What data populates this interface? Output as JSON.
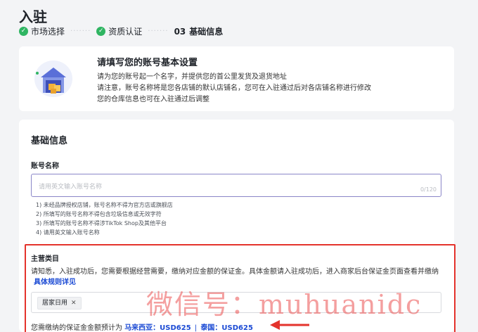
{
  "page": {
    "title": "入驻"
  },
  "steps": [
    {
      "label": "市场选择",
      "state": "done"
    },
    {
      "label": "资质认证",
      "state": "done"
    },
    {
      "number": "03",
      "label": "基础信息",
      "state": "active"
    }
  ],
  "intro": {
    "title": "请填写您的账号基本设置",
    "lines": [
      "请为您的账号起一个名字，并提供您的首公里发货及退货地址",
      "请注意，账号名称将是您各店铺的默认店铺名，您可在入驻通过后对各店铺名称进行修改",
      "您的仓库信息也可在入驻通过后调整"
    ]
  },
  "form": {
    "section_title": "基础信息",
    "account_name": {
      "label": "账号名称",
      "placeholder": "请用英文输入账号名称",
      "counter": "0/120",
      "rules": [
        "1) 未经品牌授权店铺，账号名称不得为官方店或旗舰店",
        "2) 所填写的账号名称不得包含垃圾信息或无效字符",
        "3) 所填写的账号名称不得涉TikTok Shop及其他平台",
        "4) 请用英文输入账号名称"
      ]
    },
    "category": {
      "label": "主营类目",
      "description": "请知悉，入驻成功后，您需要根据经营需要，缴纳对应金额的保证金。具体金额请入驻成功后，进入商家后台保证金页面查看并缴纳",
      "link": "具体规则详见",
      "selected_tag": "居家日用",
      "deposit_prefix": "您需缴纳的保证金金额预计为",
      "deposit_my": "马来西亚：USD625",
      "deposit_sep": "|",
      "deposit_th": "泰国：USD625"
    }
  },
  "watermark": "微信号：muhuanidc",
  "colors": {
    "accent": "#1b4ad4",
    "success": "#2fb562",
    "highlight": "#e4332c",
    "input_focus": "#8a86c8"
  }
}
